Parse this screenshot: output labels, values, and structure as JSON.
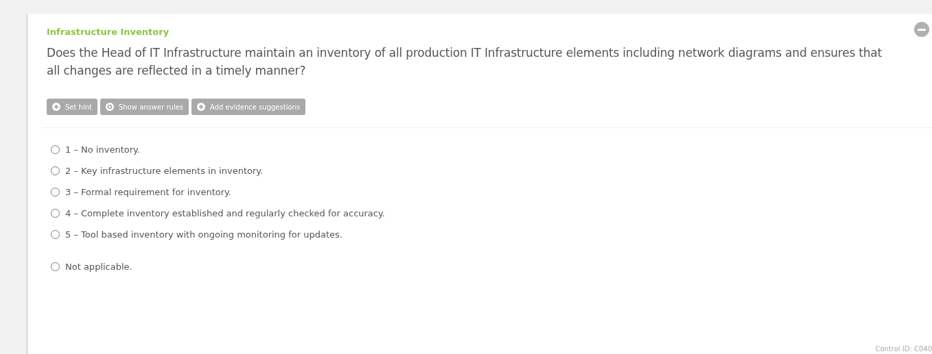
{
  "card": {
    "title": "Infrastructure Inventory",
    "collapsed": false,
    "question": "Does the Head of IT Infrastructure maintain an inventory of all production IT Infrastructure elements including network diagrams and ensures that all changes are reflected in a timely manner?",
    "actions": [
      {
        "label": "Set hint",
        "kind": "add"
      },
      {
        "label": "Show answer rules",
        "kind": "rules"
      },
      {
        "label": "Add evidence suggestions",
        "kind": "add"
      }
    ],
    "options": [
      {
        "label": "1 – No inventory.",
        "selected": false
      },
      {
        "label": "2 – Key infrastructure elements in inventory.",
        "selected": false
      },
      {
        "label": "3 – Formal requirement for inventory.",
        "selected": false
      },
      {
        "label": "4 – Complete inventory established and regularly checked for accuracy.",
        "selected": false
      },
      {
        "label": "5 – Tool based inventory with ongoing monitoring for updates.",
        "selected": false
      }
    ],
    "not_applicable": {
      "label": "Not applicable.",
      "selected": false
    },
    "control_id": "Control ID: C040"
  }
}
